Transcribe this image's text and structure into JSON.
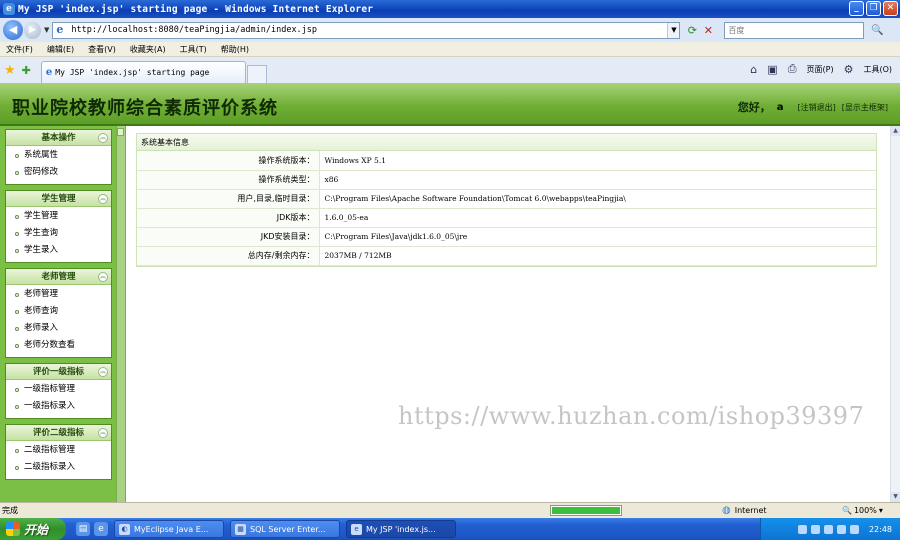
{
  "window": {
    "title": "My JSP 'index.jsp' starting page - Windows Internet Explorer"
  },
  "browser": {
    "url": "http://localhost:8080/teaPingjia/admin/index.jsp",
    "search_placeholder": "百度",
    "menu": [
      "文件(F)",
      "编辑(E)",
      "查看(V)",
      "收藏夹(A)",
      "工具(T)",
      "帮助(H)"
    ],
    "tab_label": "My JSP 'index.jsp' starting page",
    "page_menu": "页面(P)",
    "tools_menu": "工具(O)"
  },
  "header": {
    "title": "职业院校教师综合素质评价系统",
    "greeting_label": "您好，",
    "username": "a",
    "logout_link": "[注销退出]",
    "main_frame_link": "[显示主框架]"
  },
  "sidebar": {
    "panels": [
      {
        "title": "基本操作",
        "items": [
          "系统属性",
          "密码修改"
        ]
      },
      {
        "title": "学生管理",
        "items": [
          "学生管理",
          "学生查询",
          "学生录入"
        ]
      },
      {
        "title": "老师管理",
        "items": [
          "老师管理",
          "老师查询",
          "老师录入",
          "老师分数查看"
        ]
      },
      {
        "title": "评价一级指标",
        "items": [
          "一级指标管理",
          "一级指标录入"
        ]
      },
      {
        "title": "评价二级指标",
        "items": [
          "二级指标管理",
          "二级指标录入"
        ]
      }
    ]
  },
  "system_info": {
    "heading": "系统基本信息",
    "rows": [
      {
        "label": "操作系统版本：",
        "value": "Windows XP  5.1"
      },
      {
        "label": "操作系统类型：",
        "value": "x86"
      },
      {
        "label": "用户,目录,临时目录：",
        "value": "C:\\Program Files\\Apache Software Foundation\\Tomcat 6.0\\webapps\\teaPingjia\\"
      },
      {
        "label": "JDK版本：",
        "value": "1.6.0_05-ea"
      },
      {
        "label": "JKD安装目录：",
        "value": "C:\\Program Files\\Java\\jdk1.6.0_05\\jre"
      },
      {
        "label": "总内存/剩余内存：",
        "value": "2037MB  /  712MB"
      }
    ]
  },
  "watermark": "https://www.huzhan.com/ishop39397",
  "status": {
    "text": "完成",
    "zone": "Internet",
    "zoom": "100%",
    "progress_fraction": 1.0
  },
  "taskbar": {
    "start_label": "开始",
    "tasks": [
      "MyEclipse Java E...",
      "SQL Server Enter...",
      "My JSP 'index.js..."
    ],
    "clock": "22:48"
  }
}
